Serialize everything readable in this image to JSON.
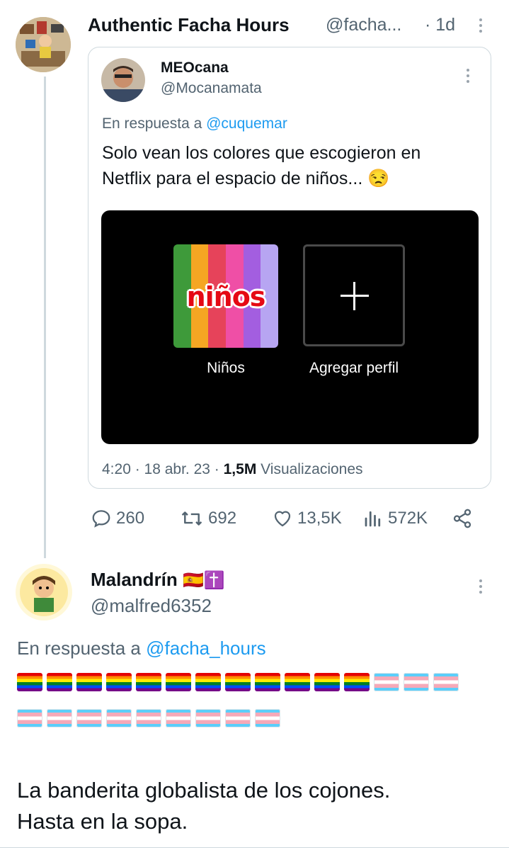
{
  "tweet1": {
    "display_name": "Authentic Facha Hours",
    "handle": "@facha...",
    "time": "· 1d",
    "stats": {
      "replies": "260",
      "retweets": "692",
      "likes": "13,5K",
      "views": "572K"
    }
  },
  "quoted": {
    "display_name": "MEOcana",
    "handle": "@Mocanamata",
    "reply_prefix": "En respuesta a",
    "reply_to": "@cuquemar",
    "text_line1": "Solo vean los colores que escogieron en",
    "text_line2": "Netflix para el espacio de niños...",
    "emoji": "😒",
    "media": {
      "tile_word": "niños",
      "profile_label": "Niños",
      "add_label": "Agregar perfil",
      "stripe_colors": [
        "#3e9a3a",
        "#f5a623",
        "#e6435a",
        "#ef4fa6",
        "#a35ee0",
        "#b7a5f2"
      ]
    },
    "meta_time": "4:20 · 18 abr. 23 ·",
    "meta_views_count": "1,5M",
    "meta_views_label": "Visualizaciones"
  },
  "reply": {
    "display_name": "Malandrín",
    "name_emojis": "🇪🇸✝️",
    "handle": "@malfred6352",
    "reply_prefix": "En respuesta a",
    "reply_to": "@facha_hours",
    "flag_rows": [
      {
        "pride": 12,
        "trans": 3
      },
      {
        "pride": 0,
        "trans": 9
      }
    ],
    "text_line1": "La banderita globalista de los cojones.",
    "text_line2": "Hasta en la sopa."
  },
  "colors": {
    "accent": "#1d9bf0",
    "secondary_text": "#536471",
    "border": "#cfd9de"
  }
}
